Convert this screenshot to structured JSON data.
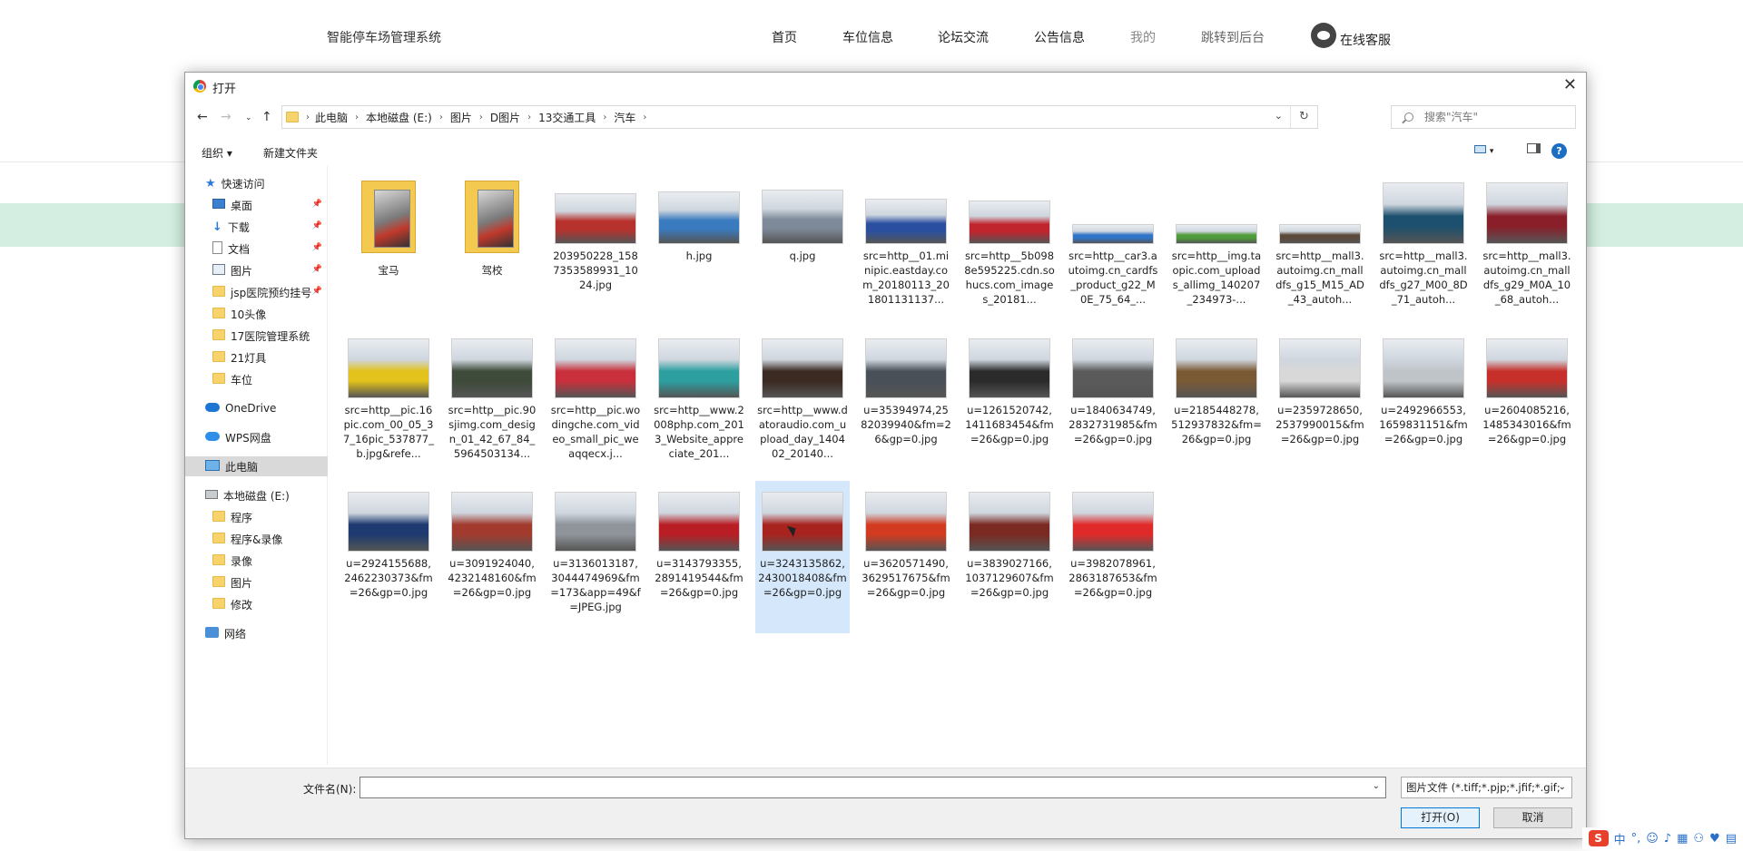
{
  "site": {
    "title": "智能停车场管理系统",
    "nav": [
      "首页",
      "车位信息",
      "论坛交流",
      "公告信息",
      "我的",
      "跳转到后台"
    ],
    "service_label": "在线客服"
  },
  "dialog": {
    "title": "打开",
    "breadcrumbs": [
      "此电脑",
      "本地磁盘 (E:)",
      "图片",
      "D图片",
      "13交通工具",
      "汽车"
    ],
    "search_placeholder": "搜索\"汽车\"",
    "toolbar": {
      "organize": "组织 ▾",
      "new_folder": "新建文件夹"
    },
    "sidebar": [
      {
        "label": "快速访问",
        "icon": "star-icon",
        "pinned": false
      },
      {
        "label": "桌面",
        "icon": "desktop-icon",
        "pinned": true
      },
      {
        "label": "下载",
        "icon": "download-icon",
        "pinned": true
      },
      {
        "label": "文档",
        "icon": "document-icon",
        "pinned": true
      },
      {
        "label": "图片",
        "icon": "picture-icon",
        "pinned": true
      },
      {
        "label": "jsp医院预约挂号",
        "icon": "folder-icon",
        "pinned": true
      },
      {
        "label": "10头像",
        "icon": "folder-icon",
        "pinned": false
      },
      {
        "label": "17医院管理系统",
        "icon": "folder-icon",
        "pinned": false
      },
      {
        "label": "21灯具",
        "icon": "folder-icon",
        "pinned": false
      },
      {
        "label": "车位",
        "icon": "folder-icon",
        "pinned": false
      },
      {
        "label": "OneDrive",
        "icon": "onedrive-icon",
        "pinned": false
      },
      {
        "label": "WPS网盘",
        "icon": "wps-cloud-icon",
        "pinned": false
      },
      {
        "label": "此电脑",
        "icon": "computer-icon",
        "pinned": false,
        "selected": true
      },
      {
        "label": "本地磁盘 (E:)",
        "icon": "drive-icon",
        "pinned": false
      },
      {
        "label": "程序",
        "icon": "folder-icon",
        "pinned": false
      },
      {
        "label": "程序&录像",
        "icon": "folder-icon",
        "pinned": false
      },
      {
        "label": "录像",
        "icon": "folder-icon",
        "pinned": false
      },
      {
        "label": "图片",
        "icon": "folder-icon",
        "pinned": false
      },
      {
        "label": "修改",
        "icon": "folder-icon",
        "pinned": false
      },
      {
        "label": "网络",
        "icon": "network-icon",
        "pinned": false
      }
    ],
    "files": [
      {
        "name": "宝马",
        "type": "folder"
      },
      {
        "name": "驾校",
        "type": "folder"
      },
      {
        "name": "203950228_1587353589931_1024.jpg",
        "type": "image",
        "color": "#b8322d"
      },
      {
        "name": "h.jpg",
        "type": "image",
        "color": "#3a7bbf"
      },
      {
        "name": "q.jpg",
        "type": "image",
        "color": "#7e8a99"
      },
      {
        "name": "src=http__01.minipic.eastday.com_20180113_201801131137...",
        "type": "image",
        "color": "#2b4fa0"
      },
      {
        "name": "src=http__5b0988e595225.cdn.sohucs.com_images_20181...",
        "type": "image",
        "color": "#c0242d"
      },
      {
        "name": "src=http__car3.autoimg.cn_cardfs_product_g22_M0E_75_64_...",
        "type": "image",
        "color": "#2f74c6"
      },
      {
        "name": "src=http__img.taopic.com_uploads_allimg_140207_234973-...",
        "type": "image",
        "color": "#4e9c3a"
      },
      {
        "name": "src=http__mall3.autoimg.cn_malldfs_g15_M15_AD_43_autoh...",
        "type": "image",
        "color": "#5b4a3a"
      },
      {
        "name": "src=http__mall3.autoimg.cn_malldfs_g27_M00_8D_71_autoh...",
        "type": "image",
        "color": "#1d4f6e"
      },
      {
        "name": "src=http__mall3.autoimg.cn_malldfs_g29_M0A_10_68_autoh...",
        "type": "image",
        "color": "#8a1f2a"
      },
      {
        "name": "src=http__pic.16pic.com_00_05_37_16pic_537877_b.jpg&refe...",
        "type": "image",
        "color": "#e2c21b"
      },
      {
        "name": "src=http__pic.90sjimg.com_design_01_42_67_84_5964503134...",
        "type": "image",
        "color": "#3e4a3a"
      },
      {
        "name": "src=http__pic.wodingche.com_video_small_pic_weaqqecx.j...",
        "type": "image",
        "color": "#c9303c"
      },
      {
        "name": "src=http__www.2008php.com_2013_Website_appreciate_201...",
        "type": "image",
        "color": "#2d9fa0"
      },
      {
        "name": "src=http__www.datoraudio.com_upload_day_140402_20140...",
        "type": "image",
        "color": "#3a2a22"
      },
      {
        "name": "u=35394974,2582039940&fm=26&gp=0.jpg",
        "type": "image",
        "color": "#4a5058"
      },
      {
        "name": "u=1261520742,1411683454&fm=26&gp=0.jpg",
        "type": "image",
        "color": "#2b2b2b"
      },
      {
        "name": "u=1840634749,2832731985&fm=26&gp=0.jpg",
        "type": "image",
        "color": "#5a5a5a"
      },
      {
        "name": "u=2185448278,512937832&fm=26&gp=0.jpg",
        "type": "image",
        "color": "#7a5a35"
      },
      {
        "name": "u=2359728650,2537990015&fm=26&gp=0.jpg",
        "type": "image",
        "color": "#d8d8d8"
      },
      {
        "name": "u=2492966553,1659831151&fm=26&gp=0.jpg",
        "type": "image",
        "color": "#bfc4c8"
      },
      {
        "name": "u=2604085216,1485343016&fm=26&gp=0.jpg",
        "type": "image",
        "color": "#c7302a"
      },
      {
        "name": "u=2924155688,2462230373&fm=26&gp=0.jpg",
        "type": "image",
        "color": "#1f3a70"
      },
      {
        "name": "u=3091924040,4232148160&fm=26&gp=0.jpg",
        "type": "image",
        "color": "#a23a2e"
      },
      {
        "name": "u=3136013187,3044474969&fm=173&app=49&f=JPEG.jpg",
        "type": "image",
        "color": "#8f949a"
      },
      {
        "name": "u=3143793355,2891419544&fm=26&gp=0.jpg",
        "type": "image",
        "color": "#b81e24"
      },
      {
        "name": "u=3243135862,2430018408&fm=26&gp=0.jpg",
        "type": "image",
        "color": "#a8231e",
        "selected": true
      },
      {
        "name": "u=3620571490,3629517675&fm=26&gp=0.jpg",
        "type": "image",
        "color": "#d23b20"
      },
      {
        "name": "u=3839027166,1037129607&fm=26&gp=0.jpg",
        "type": "image",
        "color": "#7a2a22"
      },
      {
        "name": "u=3982078961,2863187653&fm=26&gp=0.jpg",
        "type": "image",
        "color": "#e02a2a"
      }
    ],
    "filename_label": "文件名(N):",
    "filename_value": "",
    "filetype": "图片文件 (*.tiff;*.pjp;*.jfif;*.gif;",
    "open_button": "打开(O)",
    "cancel_button": "取消"
  },
  "ime": {
    "logo": "S",
    "lang": "中"
  }
}
